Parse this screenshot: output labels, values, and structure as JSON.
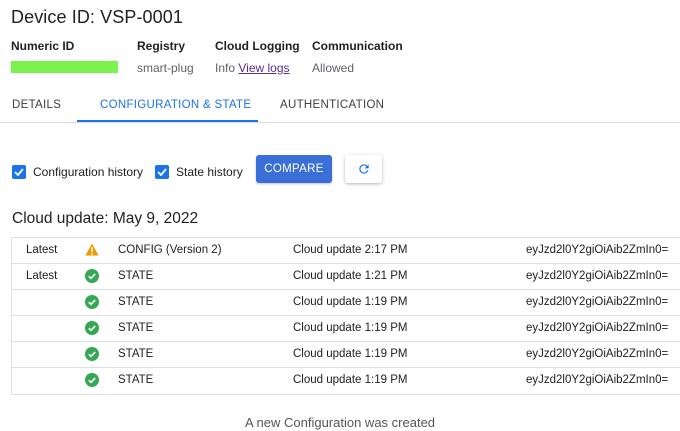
{
  "header": {
    "title": "Device ID: VSP-0001"
  },
  "meta": {
    "numeric_id": {
      "label": "Numeric ID"
    },
    "registry": {
      "label": "Registry",
      "value": "smart-plug"
    },
    "cloud_logging": {
      "label": "Cloud Logging",
      "value_prefix": "Info",
      "link": "View logs"
    },
    "communication": {
      "label": "Communication",
      "value": "Allowed"
    }
  },
  "tabs": [
    {
      "label": "DETAILS"
    },
    {
      "label": "CONFIGURATION & STATE",
      "active": true
    },
    {
      "label": "AUTHENTICATION"
    }
  ],
  "controls": {
    "config_history": {
      "label": "Configuration history",
      "checked": true
    },
    "state_history": {
      "label": "State history",
      "checked": true
    },
    "compare_label": "COMPARE",
    "refresh_icon": "refresh-icon"
  },
  "section": {
    "title": "Cloud update: May 9, 2022"
  },
  "rows": [
    {
      "latest": "Latest",
      "status": "warning",
      "type": "CONFIG (Version 2)",
      "time": "Cloud update 2:17 PM",
      "data": "eyJzd2l0Y2giOiAib2ZmIn0="
    },
    {
      "latest": "Latest",
      "status": "success",
      "type": "STATE",
      "time": "Cloud update 1:21 PM",
      "data": "eyJzd2l0Y2giOiAib2ZmIn0="
    },
    {
      "latest": "",
      "status": "success",
      "type": "STATE",
      "time": "Cloud update 1:19 PM",
      "data": "eyJzd2l0Y2giOiAib2ZmIn0="
    },
    {
      "latest": "",
      "status": "success",
      "type": "STATE",
      "time": "Cloud update 1:19 PM",
      "data": "eyJzd2l0Y2giOiAib2ZmIn0="
    },
    {
      "latest": "",
      "status": "success",
      "type": "STATE",
      "time": "Cloud update 1:19 PM",
      "data": "eyJzd2l0Y2giOiAib2ZmIn0="
    },
    {
      "latest": "",
      "status": "success",
      "type": "STATE",
      "time": "Cloud update 1:19 PM",
      "data": "eyJzd2l0Y2giOiAib2ZmIn0="
    }
  ],
  "caption": "A new Configuration was created",
  "colors": {
    "accent": "#1a73e8",
    "button": "#3b6fd8",
    "success": "#34a853",
    "warning": "#f29900",
    "redaction": "#7cf24e",
    "link": "#5b2c91"
  }
}
